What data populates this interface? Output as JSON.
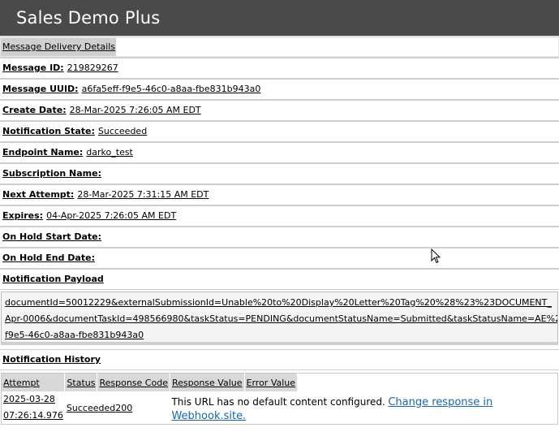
{
  "app": {
    "title": "Sales Demo Plus"
  },
  "tab": {
    "label": "Message Delivery Details"
  },
  "details": [
    {
      "label": "Message ID:",
      "value": "219829267"
    },
    {
      "label": "Message UUID:",
      "value": "a6fa5eff-f9e5-46c0-a8aa-fbe831b943a0"
    },
    {
      "label": "Create Date:",
      "value": "28-Mar-2025 7:26:05 AM EDT"
    },
    {
      "label": "Notification State:",
      "value": "Succeeded"
    },
    {
      "label": "Endpoint Name:",
      "value": "darko_test"
    },
    {
      "label": "Subscription Name:",
      "value": ""
    },
    {
      "label": "Next Attempt:",
      "value": "28-Mar-2025 7:31:15 AM EDT"
    },
    {
      "label": "Expires:",
      "value": "04-Apr-2025 7:26:05 AM EDT"
    },
    {
      "label": "On Hold Start Date:",
      "value": ""
    },
    {
      "label": "On Hold End Date:",
      "value": ""
    }
  ],
  "payload": {
    "heading": "Notification Payload",
    "lines": [
      "documentId=50012229&externalSubmissionId=Unable%20to%20Display%20Letter%20Tag%20%28%23%23DOCUMENT_",
      "Apr-0006&documentTaskId=498566980&taskStatus=PENDING&documentStatusName=Submitted&taskStatusName=AE%2",
      "f9e5-46c0-a8aa-fbe831b943a0"
    ]
  },
  "history": {
    "heading": "Notification History",
    "columns": [
      "Attempt",
      "Status",
      "Response Code",
      "Response Value",
      "Error Value"
    ],
    "rows": [
      {
        "attempt_date": "2025-03-28",
        "attempt_time": "07:26:14.976",
        "status": "Succeeded",
        "code": "200",
        "response_text": "This URL has no default content configured.",
        "response_link": "Change response in Webhook.site."
      }
    ]
  }
}
